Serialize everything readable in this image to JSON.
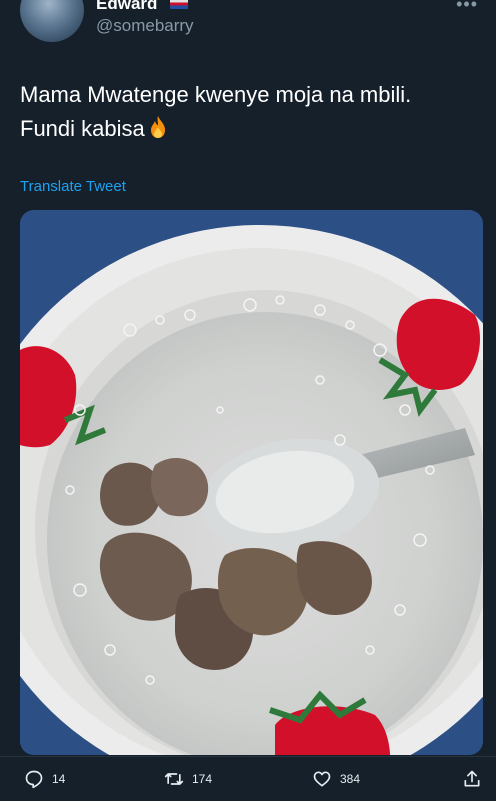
{
  "author": {
    "name": "Edward",
    "handle": "@somebarry",
    "flag_icon": "flag-icon"
  },
  "tweet": {
    "text_line1": "Mama Mwatenge kwenye moja na mbili.",
    "text_line2": "Fundi kabisa",
    "emoji_icon": "fire-icon",
    "translate_label": "Translate Tweet"
  },
  "media": {
    "icon": "soup-bowl-photo"
  },
  "actions": {
    "reply_count": "14",
    "retweet_count": "174",
    "like_count": "384"
  },
  "colors": {
    "background": "#15202b",
    "secondary_text": "#8899a6",
    "link": "#1da1f2"
  }
}
